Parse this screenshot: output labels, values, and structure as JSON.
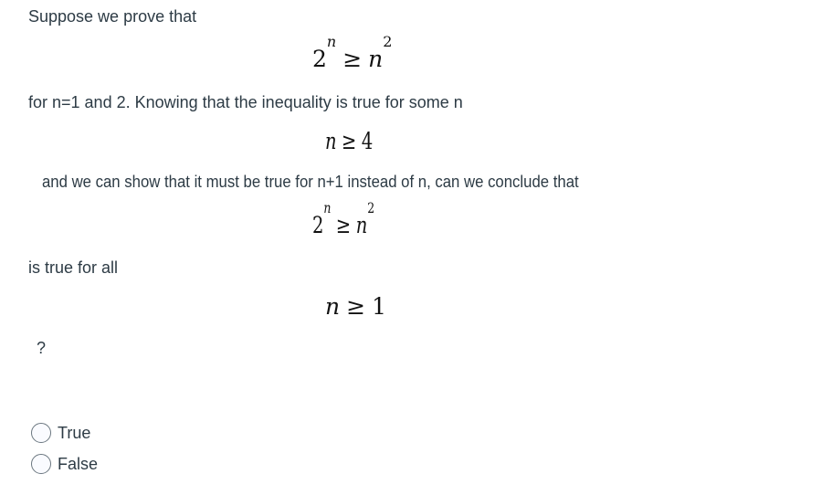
{
  "question": {
    "line1": "Suppose we prove that",
    "formula1": {
      "base": "2",
      "base_exp": "n",
      "op": "≥",
      "rhs": "n",
      "rhs_exp": "2"
    },
    "line2": "for n=1 and 2. Knowing that the inequality is true for some n",
    "formula2": {
      "lhs": "n",
      "op": "≥",
      "rhs": "4"
    },
    "line3": "and we can show that it must be true for n+1 instead of n, can we conclude that",
    "formula3": {
      "base": "2",
      "base_exp": "n",
      "op": "≥",
      "rhs": "n",
      "rhs_exp": "2"
    },
    "line4": "is true for all",
    "formula4": {
      "lhs": "n",
      "op": "≥",
      "rhs": "1"
    },
    "question_mark": "?"
  },
  "answers": [
    {
      "label": "True",
      "selected": false
    },
    {
      "label": "False",
      "selected": false
    }
  ]
}
